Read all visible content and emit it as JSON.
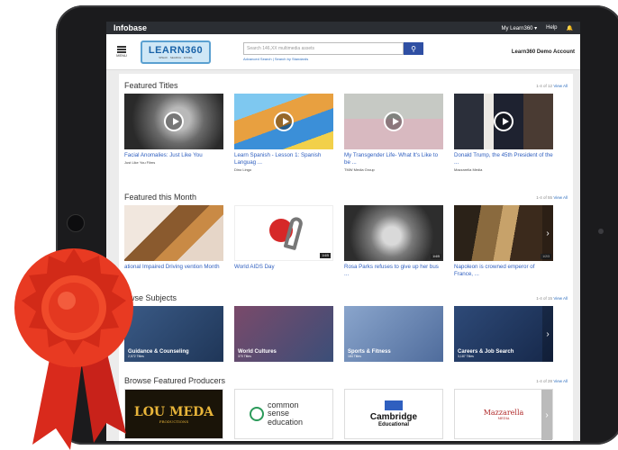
{
  "topbar": {
    "brand": "Infobase",
    "my_learn360": "My Learn360 ▾",
    "help": "Help"
  },
  "header": {
    "menu_label": "MENU",
    "logo_text": "LEARN360",
    "logo_sub": "SPEAK · SEARCH · EXCEL",
    "search_placeholder": "Search 146,XX multimedia assets",
    "search_links": "Advanced Search | Search by Standards",
    "account": "Learn360 Demo Account"
  },
  "featured_titles": {
    "title": "Featured Titles",
    "count": "1-4 of 12",
    "view_all": "View All",
    "items": [
      {
        "title": "Facial Anomalies: Just Like You",
        "producer": "Just Like You Films"
      },
      {
        "title": "Learn Spanish - Lesson 1: Spanish Languag ...",
        "producer": "Dino Lingo"
      },
      {
        "title": "My Transgender Life- What It's Like to be ...",
        "producer": "TMW Media Group"
      },
      {
        "title": "Donald Trump, the 45th President of the ...",
        "producer": "Mazzarella Media"
      }
    ]
  },
  "featured_month": {
    "title": "Featured this Month",
    "count": "1-4 of 55",
    "view_all": "View All",
    "items": [
      {
        "title": "ational Impaired Driving vention Month",
        "badge": ""
      },
      {
        "title": "World AIDS Day",
        "badge": "1/4/5"
      },
      {
        "title": "Rosa Parks refuses to give up her bus ...",
        "badge": "1/4/5"
      },
      {
        "title": "Napoleon is crowned emperor of France, ...",
        "badge": "1/2/3"
      }
    ]
  },
  "browse_subjects": {
    "title": "owse Subjects",
    "count": "1-4 of 15",
    "view_all": "View All",
    "items": [
      {
        "label": "Guidance & Counseling",
        "count": "2,572 Titles"
      },
      {
        "label": "World Cultures",
        "count": "370 Titles"
      },
      {
        "label": "Sports & Fitness",
        "count": "184 Titles"
      },
      {
        "label": "Careers & Job Search",
        "count": "3,187 Titles"
      }
    ]
  },
  "producers": {
    "title": "Browse Featured Producers",
    "count": "1-4 of 28",
    "view_all": "View All",
    "items": [
      {
        "name": "LOU MEDA",
        "sub": "PRODUCTIONS"
      },
      {
        "name": "common sense education"
      },
      {
        "name": "Cambridge",
        "sub": "Educational"
      },
      {
        "name": "Mazzarella",
        "sub": "MEDIA"
      }
    ]
  }
}
